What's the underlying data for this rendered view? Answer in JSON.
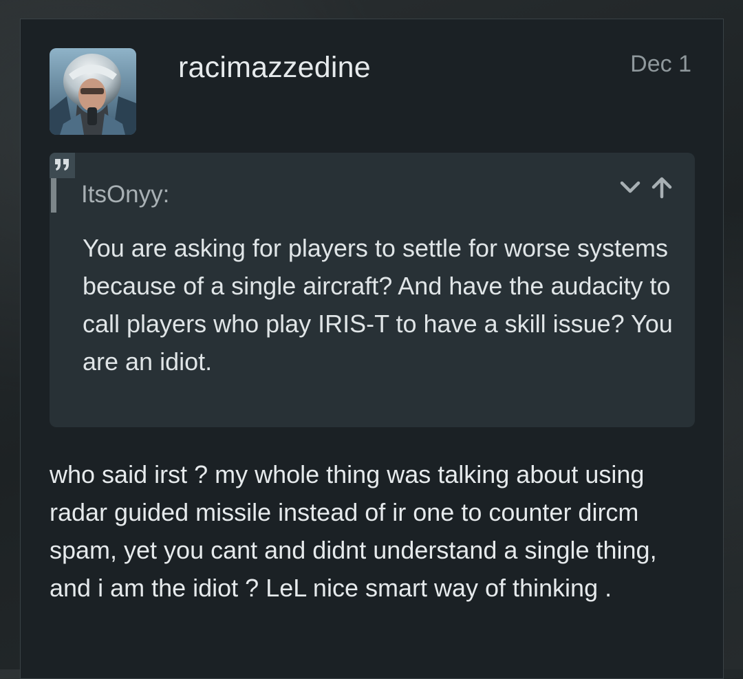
{
  "post": {
    "username": "racimazzedine",
    "date": "Dec 1",
    "quote": {
      "author": "ItsOnyy:",
      "text": "You are asking for players to settle for worse systems because of a single aircraft? And have the audacity to call players who play IRIS-T to have a skill issue? You are an idiot.",
      "quote_icon": "quote-icon",
      "expand_icon": "chevron-down-icon",
      "jump_icon": "arrow-up-icon"
    },
    "body": "who said irst ? my whole thing was talking about using radar guided missile instead of ir one to counter dircm spam, yet you cant and didnt understand a single thing, and i am the idiot ? LeL nice smart way of thinking ."
  },
  "colors": {
    "background": "#1c2124",
    "card": "#1b2125",
    "quote_background": "#283136",
    "text": "#e6eaec",
    "muted": "#8f989c"
  }
}
